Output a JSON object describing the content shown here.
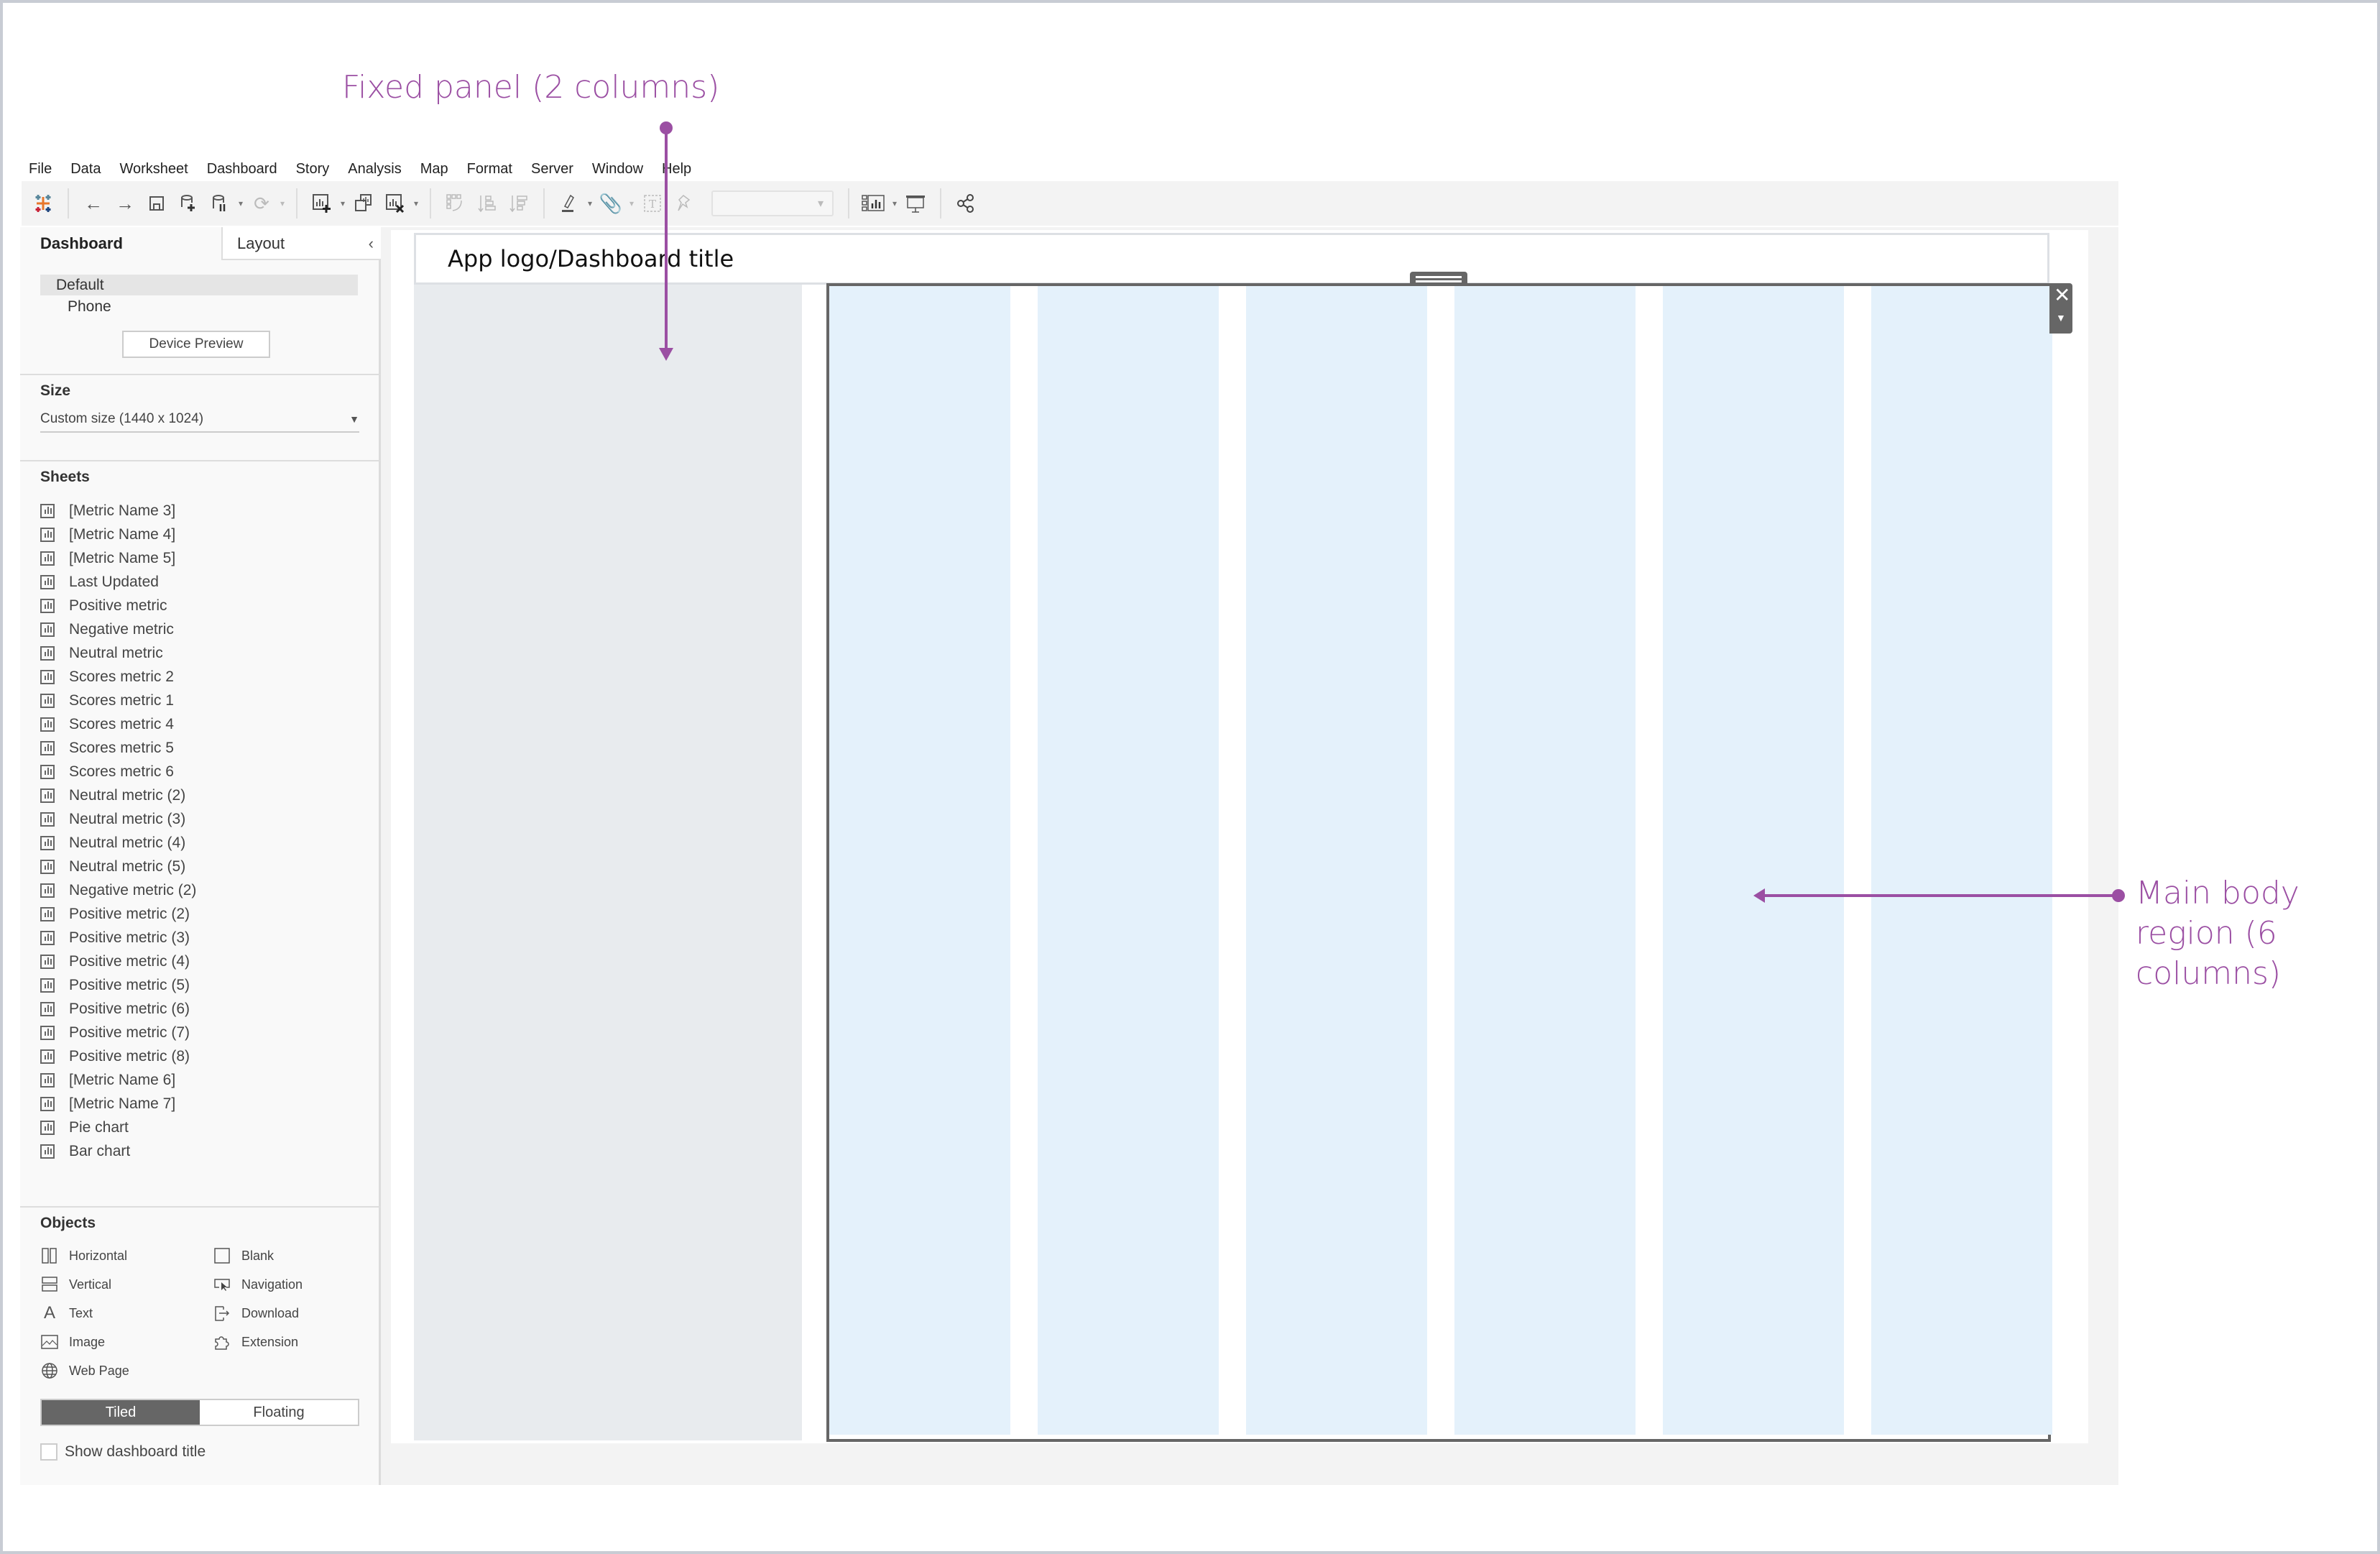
{
  "annotations": {
    "fixed_panel": "Fixed panel (2 columns)",
    "main_body": "Main body region (6 columns)",
    "color": "#9b4fa3"
  },
  "menu": [
    "File",
    "Data",
    "Worksheet",
    "Dashboard",
    "Story",
    "Analysis",
    "Map",
    "Format",
    "Server",
    "Window",
    "Help"
  ],
  "toolbar": {
    "icons": [
      "tableau-logo-icon",
      "undo-icon",
      "redo-icon",
      "save-icon",
      "new-data-source-icon",
      "pause-auto-updates-icon",
      "refresh-icon",
      "new-worksheet-icon",
      "duplicate-sheet-icon",
      "clear-sheet-icon",
      "swap-rows-columns-icon",
      "sort-ascending-icon",
      "sort-descending-icon",
      "highlight-icon",
      "group-members-icon",
      "show-mark-labels-icon",
      "fix-axes-icon",
      "fit-select",
      "show-me-icon",
      "presentation-mode-icon",
      "share-icon"
    ],
    "fit_select_value": ""
  },
  "panel": {
    "tabs": {
      "dashboard": "Dashboard",
      "layout": "Layout"
    },
    "devices": {
      "default": "Default",
      "phone": "Phone",
      "preview_button": "Device Preview"
    },
    "size": {
      "title": "Size",
      "value": "Custom size (1440 x 1024)"
    },
    "sheets": {
      "title": "Sheets",
      "items": [
        "[Metric Name 3]",
        "[Metric Name 4]",
        "[Metric Name 5]",
        "Last Updated",
        "Positive metric",
        "Negative metric",
        "Neutral metric",
        "Scores metric 2",
        "Scores metric 1",
        "Scores metric 4",
        "Scores metric 5",
        "Scores metric 6",
        "Neutral metric (2)",
        "Neutral metric (3)",
        "Neutral metric (4)",
        "Neutral metric (5)",
        "Negative metric (2)",
        "Positive metric (2)",
        "Positive metric (3)",
        "Positive metric (4)",
        "Positive metric (5)",
        "Positive metric (6)",
        "Positive metric (7)",
        "Positive metric (8)",
        "[Metric Name 6]",
        "[Metric Name 7]",
        "Pie chart",
        "Bar chart"
      ]
    },
    "objects": {
      "title": "Objects",
      "left": [
        {
          "label": "Horizontal",
          "icon": "horizontal-container-icon"
        },
        {
          "label": "Vertical",
          "icon": "vertical-container-icon"
        },
        {
          "label": "Text",
          "icon": "text-icon"
        },
        {
          "label": "Image",
          "icon": "image-icon"
        },
        {
          "label": "Web Page",
          "icon": "web-page-icon"
        }
      ],
      "right": [
        {
          "label": "Blank",
          "icon": "blank-icon"
        },
        {
          "label": "Navigation",
          "icon": "navigation-icon"
        },
        {
          "label": "Download",
          "icon": "download-icon"
        },
        {
          "label": "Extension",
          "icon": "extension-icon"
        }
      ],
      "tiled": "Tiled",
      "floating": "Floating",
      "show_title": "Show dashboard title",
      "show_title_checked": false
    }
  },
  "dashboard": {
    "title": "App logo/Dashboard title",
    "main_body_columns": 6,
    "fixed_panel_columns": 2,
    "column_color": "#e4f1fb",
    "fixed_panel_color": "#e8ebee"
  }
}
